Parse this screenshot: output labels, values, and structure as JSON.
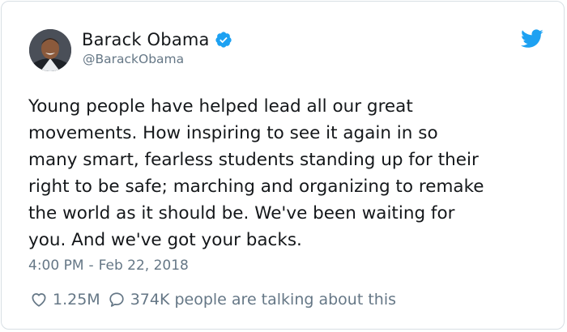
{
  "author": {
    "name": "Barack Obama",
    "handle": "@BarackObama",
    "verified": true
  },
  "tweet": {
    "text": "Young people have helped lead all our great\nmovements. How inspiring to see it again in so\nmany smart, fearless students standing up for their\nright to be safe; marching and organizing to remake\nthe world as it should be. We've been waiting for\nyou. And we've got your backs.",
    "time": "4:00 PM",
    "separator": "-",
    "date": "Feb 22, 2018"
  },
  "stats": {
    "likes": "1.25M",
    "talking": "374K people are talking about this"
  },
  "colors": {
    "text": "#14171a",
    "muted": "#657786",
    "brand": "#1da1f2",
    "border": "#d8dfe4"
  },
  "icons": {
    "avatar": "profile-photo",
    "verified": "verified-badge-icon",
    "brand": "twitter-bird-icon",
    "like": "heart-outline-icon",
    "reply": "speech-bubble-icon"
  }
}
